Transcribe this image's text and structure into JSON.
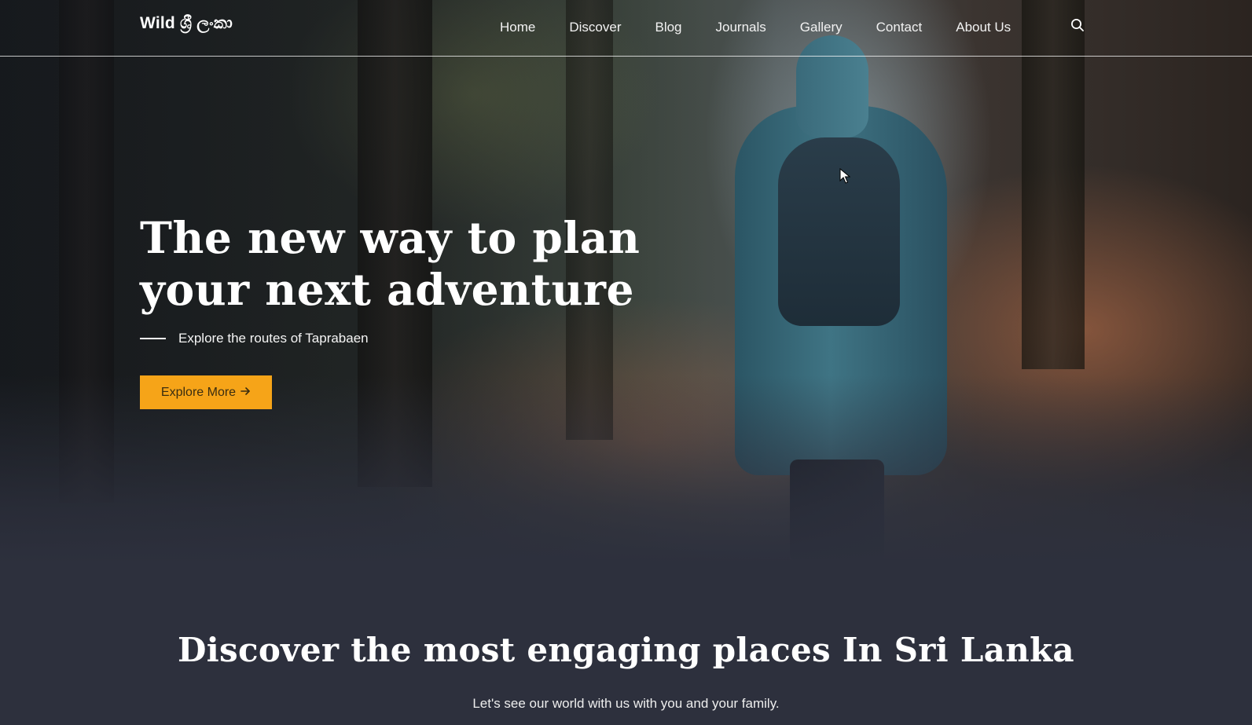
{
  "brand": {
    "name": "Wild ශ්‍රී ලංකා"
  },
  "nav": {
    "items": [
      {
        "label": "Home"
      },
      {
        "label": "Discover"
      },
      {
        "label": "Blog"
      },
      {
        "label": "Journals"
      },
      {
        "label": "Gallery"
      },
      {
        "label": "Contact"
      },
      {
        "label": "About Us"
      }
    ],
    "search_icon": "search-icon"
  },
  "hero": {
    "title_line1": "The new way to plan",
    "title_line2": "your next adventure",
    "subtitle": "Explore the routes of Taprabaen",
    "cta_label": "Explore More",
    "cta_icon": "arrow-right-icon"
  },
  "discover": {
    "title": "Discover the most engaging places In Sri Lanka",
    "subtitle": "Let's see our world with us with you and your family."
  },
  "colors": {
    "accent": "#f6a418",
    "section_bg": "#2d303d",
    "text": "#ffffff"
  }
}
